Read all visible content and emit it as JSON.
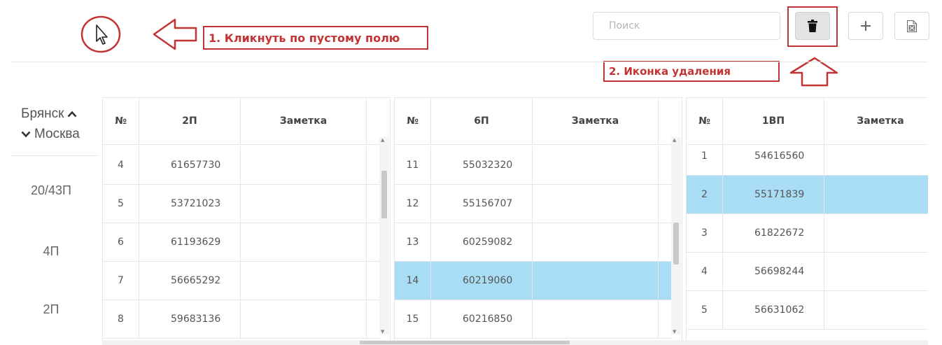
{
  "annotations": {
    "step1": "1. Кликнуть по пустому полю",
    "step2": "2. Иконка удаления"
  },
  "toolbar": {
    "search_placeholder": "Поиск",
    "delete_icon": "trash-icon",
    "add_icon": "plus-icon",
    "export_icon": "excel-file-icon"
  },
  "sidebar": {
    "route_from": "Брянск",
    "route_to": "Москва",
    "rows": [
      "20/43П",
      "4П",
      "2П"
    ]
  },
  "tables": [
    {
      "headers": [
        "№",
        "2П",
        "Заметка"
      ],
      "rows": [
        {
          "n": "4",
          "num": "61657730",
          "note": ""
        },
        {
          "n": "5",
          "num": "53721023",
          "note": ""
        },
        {
          "n": "6",
          "num": "61193629",
          "note": ""
        },
        {
          "n": "7",
          "num": "56665292",
          "note": ""
        },
        {
          "n": "8",
          "num": "59683136",
          "note": ""
        }
      ]
    },
    {
      "headers": [
        "№",
        "6П",
        "Заметка"
      ],
      "rows": [
        {
          "n": "11",
          "num": "55032320",
          "note": ""
        },
        {
          "n": "12",
          "num": "55156707",
          "note": ""
        },
        {
          "n": "13",
          "num": "60259082",
          "note": ""
        },
        {
          "n": "14",
          "num": "60219060",
          "note": "",
          "selected": true
        },
        {
          "n": "15",
          "num": "60216850",
          "note": ""
        }
      ]
    },
    {
      "headers": [
        "№",
        "1ВП",
        "Заметка"
      ],
      "rows": [
        {
          "n": "1",
          "num": "54616560",
          "note": ""
        },
        {
          "n": "2",
          "num": "55171839",
          "note": "",
          "selected": true
        },
        {
          "n": "3",
          "num": "61822672",
          "note": ""
        },
        {
          "n": "4",
          "num": "56698244",
          "note": ""
        },
        {
          "n": "5",
          "num": "56631062",
          "note": ""
        }
      ]
    }
  ],
  "colors": {
    "annotation": "#c23434",
    "selected_row": "#a9ddf5"
  }
}
